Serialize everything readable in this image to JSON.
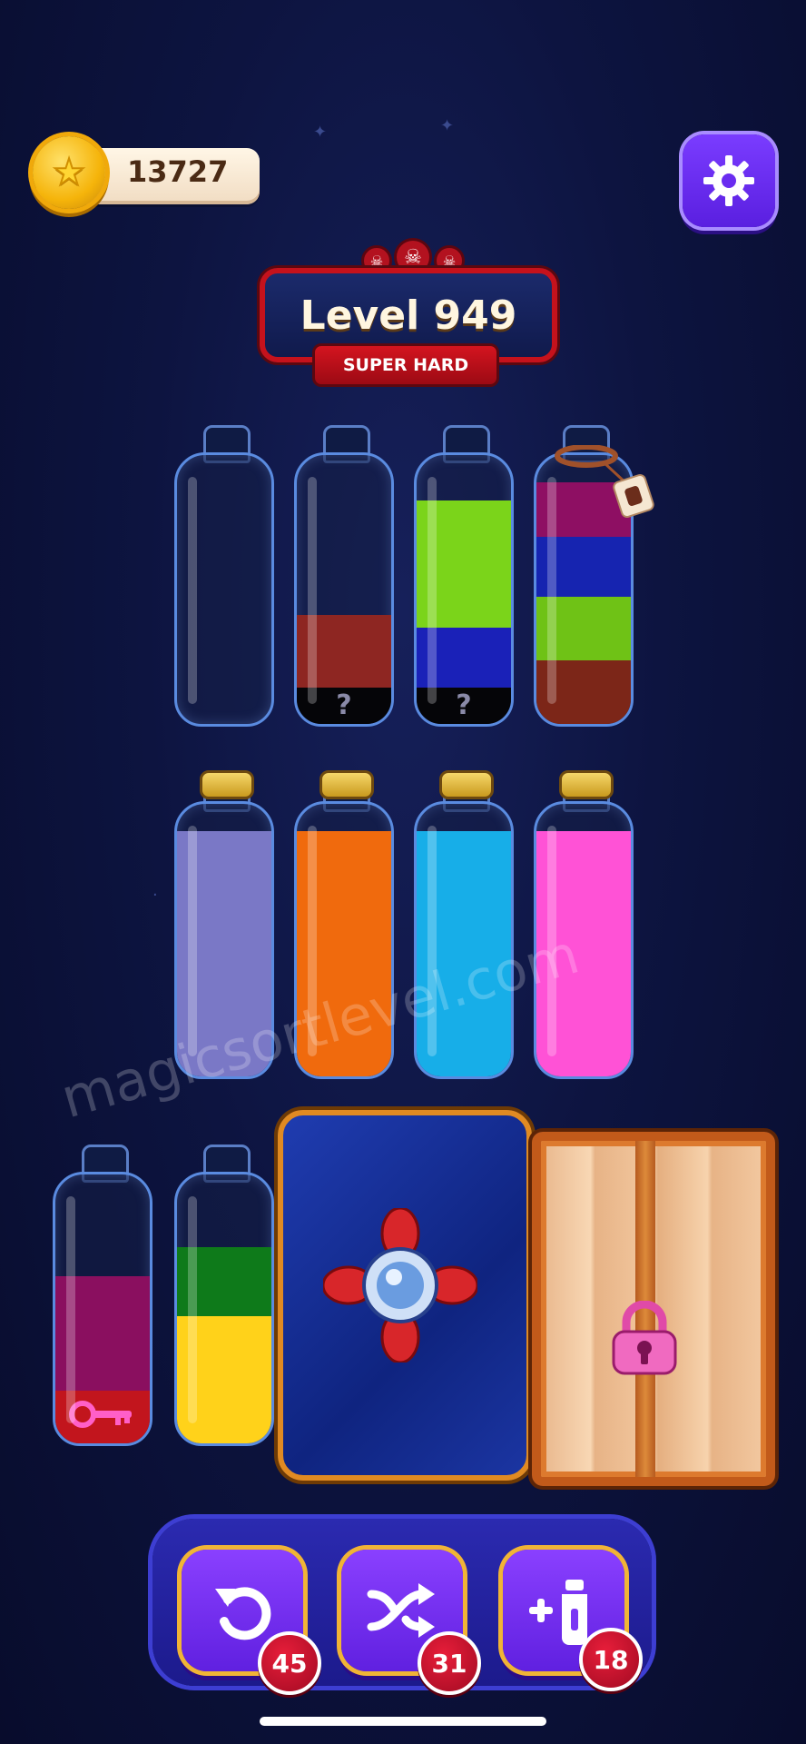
{
  "hud": {
    "coins": "13727",
    "settings_icon": "gear-icon"
  },
  "level": {
    "title": "Level 949",
    "difficulty": "SUPER HARD",
    "difficulty_icons": [
      "skull-icon",
      "skull-icon",
      "skull-icon"
    ]
  },
  "bottles": [
    {
      "id": "b1",
      "sealed": false,
      "layers": [],
      "hidden": []
    },
    {
      "id": "b2",
      "sealed": false,
      "layers": [
        "#8e2622"
      ],
      "hidden": [
        "?"
      ]
    },
    {
      "id": "b3",
      "sealed": false,
      "layers": [
        "#7bd41a",
        "#7bd41a",
        "#1a21b8"
      ],
      "hidden": [
        "?"
      ]
    },
    {
      "id": "b4",
      "sealed": false,
      "roped": true,
      "layers": [
        "#8e0f63",
        "#1624b0",
        "#6fc216",
        "#7c2618"
      ],
      "hidden": []
    },
    {
      "id": "b5",
      "sealed": true,
      "layers": [
        "#7a78c6"
      ],
      "hidden": []
    },
    {
      "id": "b6",
      "sealed": true,
      "layers": [
        "#f06a0d"
      ],
      "hidden": []
    },
    {
      "id": "b7",
      "sealed": true,
      "layers": [
        "#17aee8"
      ],
      "hidden": []
    },
    {
      "id": "b8",
      "sealed": true,
      "layers": [
        "#ff52d6"
      ],
      "hidden": []
    },
    {
      "id": "b9",
      "sealed": false,
      "layers": [
        "#8a0f5f",
        "#c2151d"
      ],
      "hidden": [],
      "item": "key-icon"
    },
    {
      "id": "b10",
      "sealed": false,
      "layers": [
        "#0e7a1a",
        "#ffd21a"
      ],
      "hidden": []
    }
  ],
  "obstacles": {
    "frozen_bottle": "ice-spike-lock",
    "crate": "locked-crate"
  },
  "tools": [
    {
      "name": "undo",
      "icon": "undo-icon",
      "count": "45"
    },
    {
      "name": "shuffle",
      "icon": "shuffle-icon",
      "count": "31"
    },
    {
      "name": "add-bottle",
      "icon": "add-bottle-icon",
      "count": "18"
    }
  ],
  "watermark": "magicsortlevel.com"
}
